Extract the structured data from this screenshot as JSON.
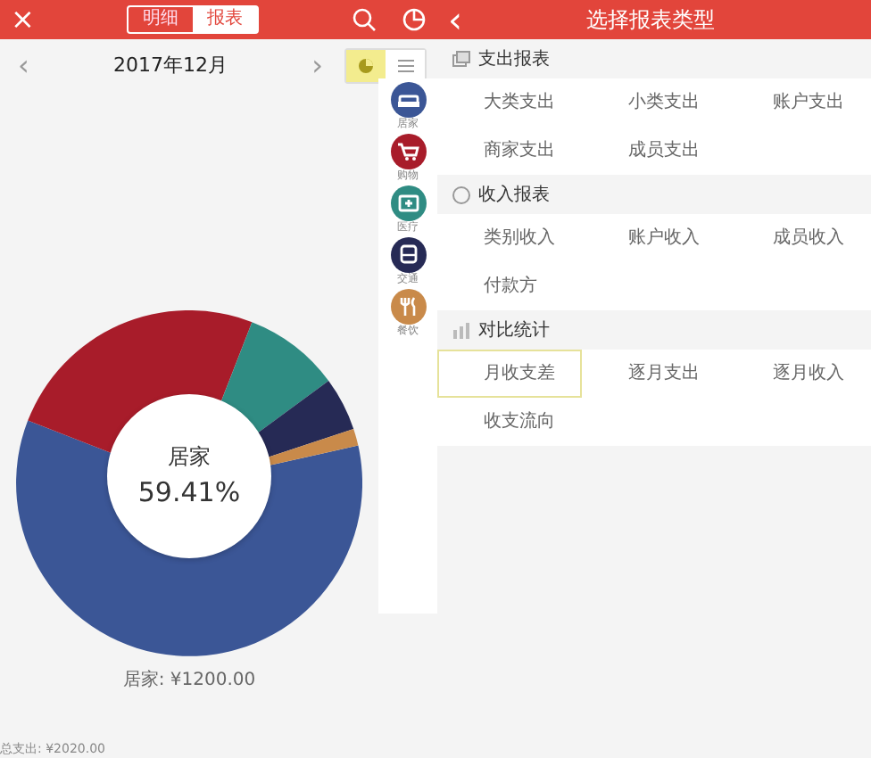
{
  "left": {
    "close": "×",
    "tabs": [
      {
        "label": "明细",
        "selected": false
      },
      {
        "label": "报表",
        "selected": true
      }
    ],
    "month": "2017年12月",
    "prev": "‹",
    "next": "›",
    "views": [
      {
        "kind": "pie",
        "selected": true
      },
      {
        "kind": "list",
        "selected": false
      }
    ],
    "legend": [
      {
        "label": "居家",
        "color": "#3b5696",
        "kind": "sofa"
      },
      {
        "label": "购物",
        "color": "#a81c2a",
        "kind": "cart"
      },
      {
        "label": "医疗",
        "color": "#2f8c83",
        "kind": "med"
      },
      {
        "label": "交通",
        "color": "#262a55",
        "kind": "bus"
      },
      {
        "label": "餐饮",
        "color": "#c98a4a",
        "kind": "food"
      }
    ],
    "tooltip": {
      "name": "居家",
      "percent": "59.41%"
    },
    "selected_label": "居家: ¥1200.00",
    "total": "总支出: ¥2020.00"
  },
  "right": {
    "back": "‹",
    "title": "选择报表类型",
    "sections": [
      {
        "title": "支出报表",
        "kind": "stack",
        "items": [
          {
            "label": "大类支出",
            "selected": false
          },
          {
            "label": "小类支出",
            "selected": false
          },
          {
            "label": "账户支出",
            "selected": false
          },
          {
            "label": "商家支出",
            "selected": false
          },
          {
            "label": "成员支出",
            "selected": false
          }
        ]
      },
      {
        "title": "收入报表",
        "kind": "circle",
        "items": [
          {
            "label": "类别收入",
            "selected": false
          },
          {
            "label": "账户收入",
            "selected": false
          },
          {
            "label": "成员收入",
            "selected": false
          },
          {
            "label": "付款方",
            "selected": false
          }
        ]
      },
      {
        "title": "对比统计",
        "kind": "bars",
        "items": [
          {
            "label": "月收支差",
            "selected": true
          },
          {
            "label": "逐月支出",
            "selected": false
          },
          {
            "label": "逐月收入",
            "selected": false
          },
          {
            "label": "收支流向",
            "selected": false
          }
        ]
      }
    ]
  }
}
